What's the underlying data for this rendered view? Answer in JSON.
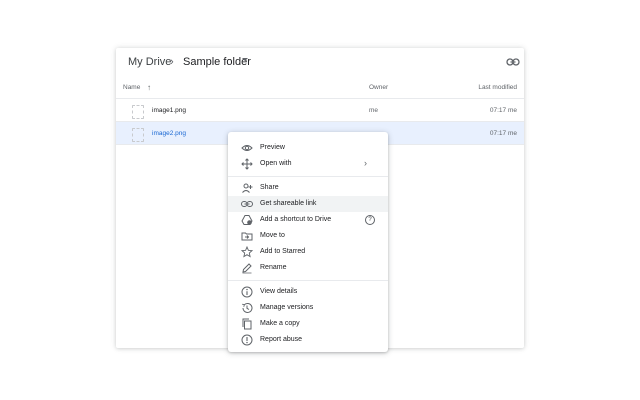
{
  "breadcrumb": {
    "root": "My Drive",
    "separator": "›",
    "current": "Sample folder"
  },
  "columns": {
    "name": "Name",
    "sort_arrow": "↑",
    "owner": "Owner",
    "modified": "Last modified"
  },
  "files": [
    {
      "name": "image1.png",
      "owner": "me",
      "modified": "07:17 me",
      "selected": false
    },
    {
      "name": "image2.png",
      "owner": "",
      "modified": "07:17 me",
      "selected": true
    }
  ],
  "context_menu": {
    "preview": "Preview",
    "open_with": "Open with",
    "open_with_chevron": "›",
    "share": "Share",
    "get_link": "Get shareable link",
    "add_shortcut": "Add a shortcut to Drive",
    "help_glyph": "?",
    "move_to": "Move to",
    "add_starred": "Add to Starred",
    "rename": "Rename",
    "view_details": "View details",
    "manage_versions": "Manage versions",
    "make_copy": "Make a copy",
    "report_abuse": "Report abuse"
  },
  "colors": {
    "selected_row_bg": "#e8f0fe",
    "selected_text": "#1967d2",
    "hover_item_bg": "#f1f3f4",
    "icon_gray": "#5f6368"
  },
  "icons": [
    "link-icon",
    "eye-icon",
    "move-arrows-icon",
    "person-add-icon",
    "link-icon",
    "drive-shortcut-icon",
    "folder-move-icon",
    "star-icon",
    "pencil-icon",
    "info-icon",
    "history-icon",
    "copy-icon",
    "report-icon"
  ]
}
